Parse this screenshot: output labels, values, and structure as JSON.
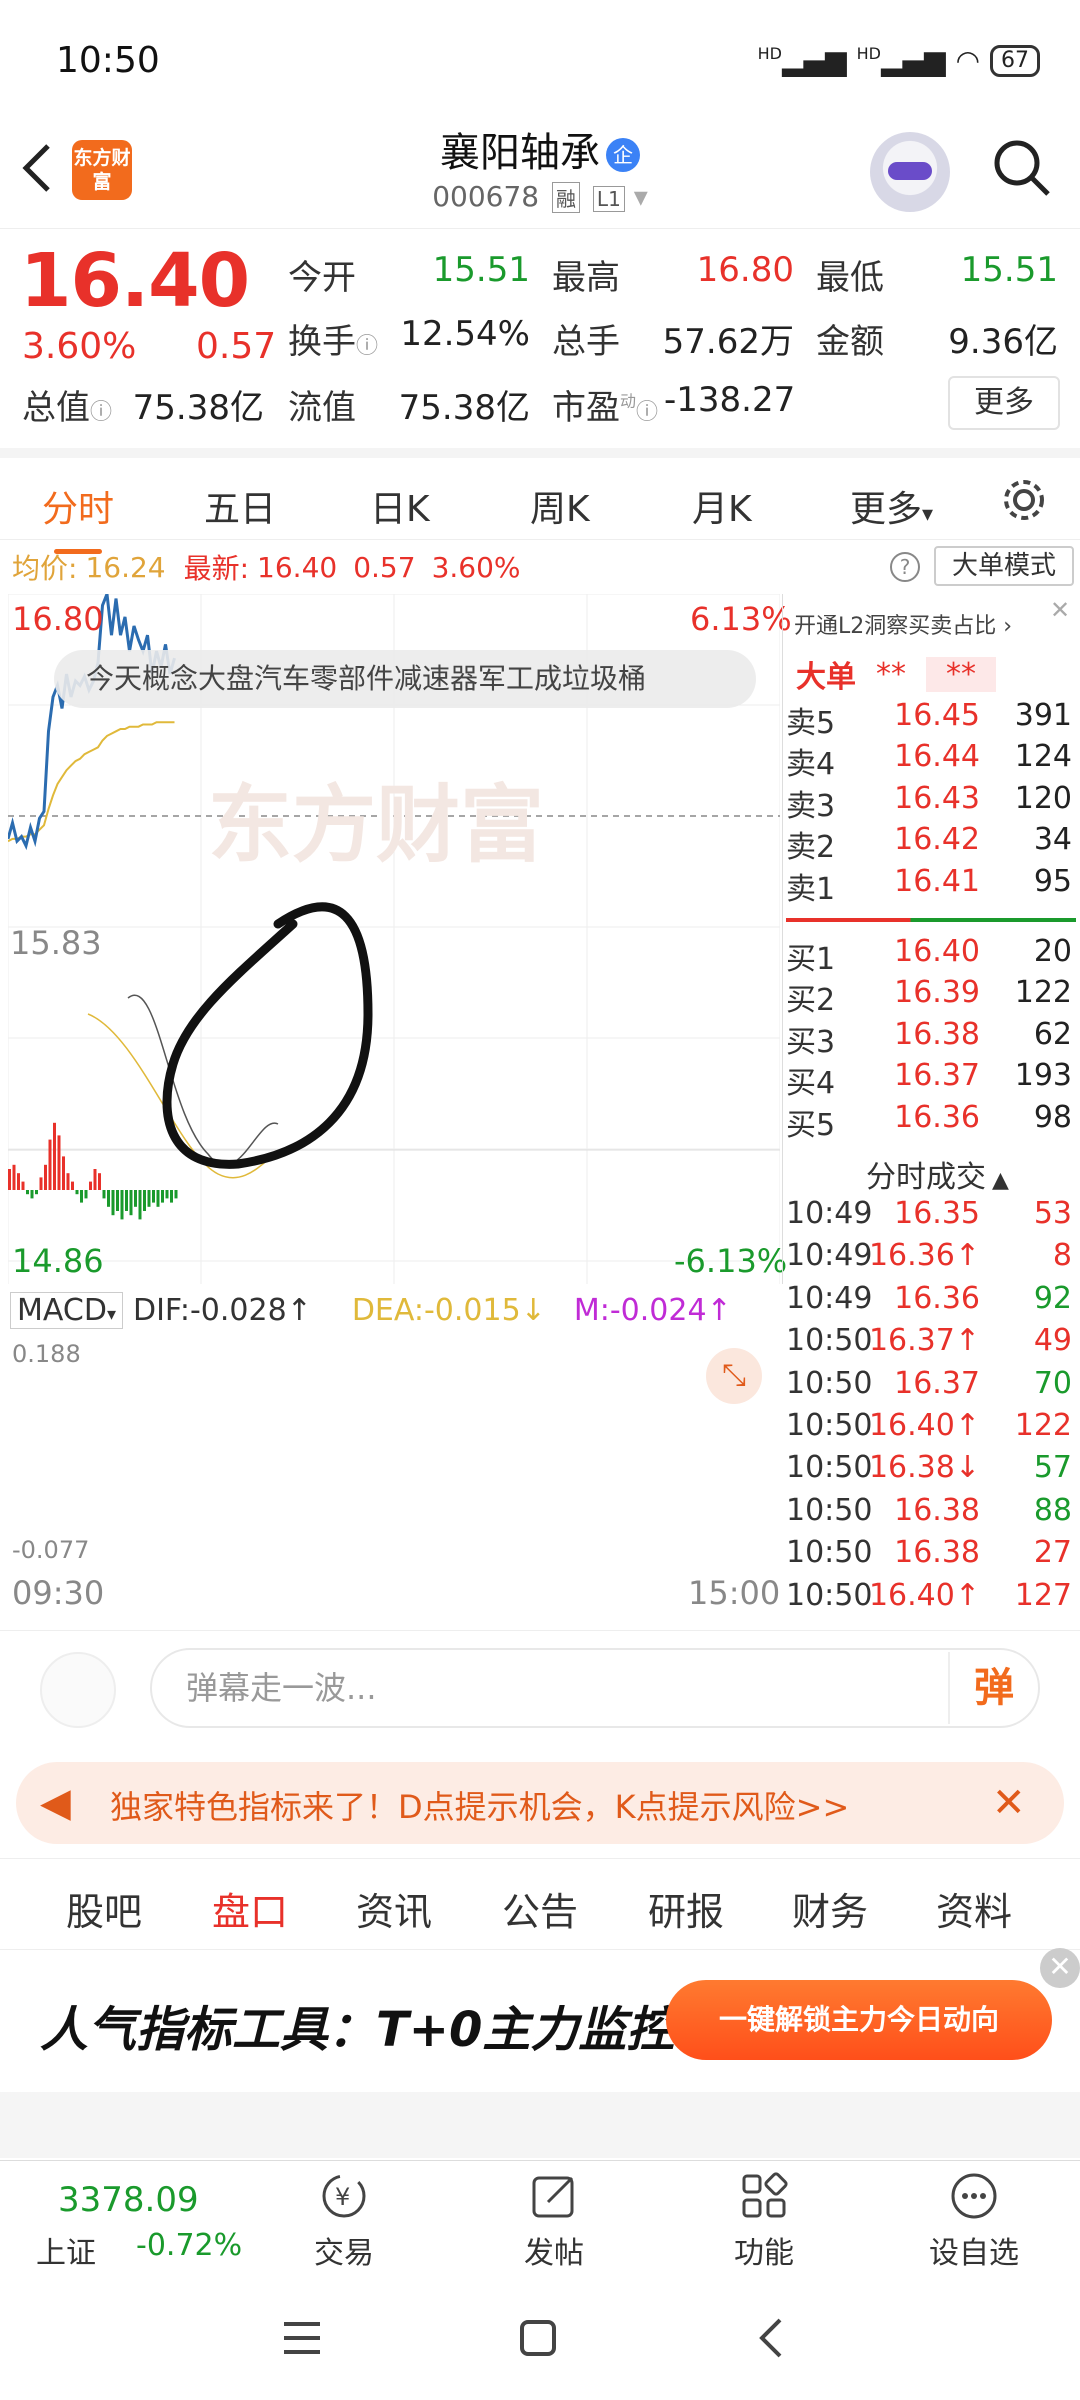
{
  "status": {
    "time": "10:50",
    "signal1": "HD",
    "signal2": "HD",
    "battery": "67"
  },
  "header": {
    "logo": "东方财富",
    "stock_name": "襄阳轴承",
    "badge": "企",
    "code": "000678",
    "tags": [
      "融",
      "L1"
    ]
  },
  "quote": {
    "price": "16.40",
    "pct": "3.60%",
    "change": "0.57",
    "fields": [
      {
        "label": "今开",
        "value": "15.51",
        "color": "green"
      },
      {
        "label": "最高",
        "value": "16.80",
        "color": "red"
      },
      {
        "label": "最低",
        "value": "15.51",
        "color": "green"
      },
      {
        "label": "换手",
        "value": "12.54%",
        "color": "black"
      },
      {
        "label": "总手",
        "value": "57.62万",
        "color": "black"
      },
      {
        "label": "金额",
        "value": "9.36亿",
        "color": "black"
      },
      {
        "label": "总值",
        "value": "75.38亿",
        "color": "black"
      },
      {
        "label": "流值",
        "value": "75.38亿",
        "color": "black"
      },
      {
        "label": "市盈",
        "value": "-138.27",
        "color": "black"
      }
    ],
    "more": "更多",
    "pe_sup": "动"
  },
  "chart_tabs": [
    "分时",
    "五日",
    "日K",
    "周K",
    "月K",
    "更多"
  ],
  "infoline": {
    "avg_label": "均价:",
    "avg_value": "16.24",
    "latest_label": "最新:",
    "latest_value": "16.40",
    "latest_change": "0.57",
    "latest_pct": "3.60%",
    "help": "?",
    "big_order_mode": "大单模式"
  },
  "chart": {
    "ticker": "今天概念大盘汽车零部件减速器军工成垃圾桶",
    "watermark": "东方财富",
    "y_top": "16.80",
    "y_mid": "15.83",
    "y_bottom": "14.86",
    "pct_top": "6.13%",
    "pct_bottom": "-6.13%",
    "macd_label": "MACD",
    "dif": "DIF:-0.028↑",
    "dea": "DEA:-0.015↓",
    "m": "M:-0.024↑",
    "macd_top": "0.188",
    "macd_bottom": "-0.077",
    "time_start": "09:30",
    "time_end": "15:00"
  },
  "chart_data": {
    "type": "line",
    "ylim": [
      14.86,
      16.8
    ],
    "series": [
      {
        "name": "",
        "values": [
          15.73,
          15.8,
          15.72,
          15.74,
          15.7,
          15.78,
          15.72,
          15.82,
          15.85,
          16.2,
          16.35,
          16.4,
          16.3,
          16.45,
          16.35,
          16.42,
          16.4,
          16.44,
          16.38,
          16.42,
          16.5,
          16.75,
          16.8,
          16.62,
          16.78,
          16.62,
          16.7,
          16.55,
          16.66,
          16.6,
          16.55,
          16.62,
          16.45,
          16.55,
          16.48,
          16.58,
          16.45,
          16.52
        ]
      },
      {
        "name": "",
        "values": [
          15.72,
          15.73,
          15.73,
          15.74,
          15.74,
          15.75,
          15.75,
          15.77,
          15.79,
          15.86,
          15.92,
          15.97,
          16.0,
          16.03,
          16.05,
          16.07,
          16.08,
          16.1,
          16.11,
          16.12,
          16.13,
          16.16,
          16.18,
          16.19,
          16.2,
          16.21,
          16.21,
          16.22,
          16.22,
          16.22,
          16.23,
          16.23,
          16.23,
          16.24,
          16.24,
          16.24,
          16.24,
          16.24
        ]
      }
    ],
    "macd_hist": [
      0.05,
      0.06,
      0.04,
      0.02,
      -0.01,
      -0.02,
      -0.01,
      0.03,
      0.06,
      0.12,
      0.16,
      0.13,
      0.08,
      0.04,
      0.02,
      -0.01,
      -0.03,
      -0.02,
      0.02,
      0.05,
      0.04,
      -0.02,
      -0.04,
      -0.06,
      -0.05,
      -0.07,
      -0.05,
      -0.06,
      -0.04,
      -0.07,
      -0.05,
      -0.04,
      -0.03,
      -0.04,
      -0.03,
      -0.02,
      -0.03,
      -0.02
    ]
  },
  "orderbook": {
    "header": "开通L2洞察买卖占比",
    "big_label": "大单",
    "big_mask1": "**",
    "big_mask2": "**",
    "asks": [
      {
        "label": "卖5",
        "price": "16.45",
        "vol": "391"
      },
      {
        "label": "卖4",
        "price": "16.44",
        "vol": "124"
      },
      {
        "label": "卖3",
        "price": "16.43",
        "vol": "120"
      },
      {
        "label": "卖2",
        "price": "16.42",
        "vol": "34"
      },
      {
        "label": "卖1",
        "price": "16.41",
        "vol": "95"
      }
    ],
    "bids": [
      {
        "label": "买1",
        "price": "16.40",
        "vol": "20"
      },
      {
        "label": "买2",
        "price": "16.39",
        "vol": "122"
      },
      {
        "label": "买3",
        "price": "16.38",
        "vol": "62"
      },
      {
        "label": "买4",
        "price": "16.37",
        "vol": "193"
      },
      {
        "label": "买5",
        "price": "16.36",
        "vol": "98"
      }
    ],
    "trades_title": "分时成交",
    "trades": [
      {
        "time": "10:49",
        "price": "16.35",
        "vol": "53",
        "price_color": "red",
        "vol_color": "red"
      },
      {
        "time": "10:49",
        "price": "16.36↑",
        "vol": "8",
        "price_color": "red",
        "vol_color": "red"
      },
      {
        "time": "10:49",
        "price": "16.36",
        "vol": "92",
        "price_color": "red",
        "vol_color": "green"
      },
      {
        "time": "10:50",
        "price": "16.37↑",
        "vol": "49",
        "price_color": "red",
        "vol_color": "red"
      },
      {
        "time": "10:50",
        "price": "16.37",
        "vol": "70",
        "price_color": "red",
        "vol_color": "green"
      },
      {
        "time": "10:50",
        "price": "16.40↑",
        "vol": "122",
        "price_color": "red",
        "vol_color": "red"
      },
      {
        "time": "10:50",
        "price": "16.38↓",
        "vol": "57",
        "price_color": "red",
        "vol_color": "green"
      },
      {
        "time": "10:50",
        "price": "16.38",
        "vol": "88",
        "price_color": "red",
        "vol_color": "green"
      },
      {
        "time": "10:50",
        "price": "16.38",
        "vol": "27",
        "price_color": "red",
        "vol_color": "red"
      },
      {
        "time": "10:50",
        "price": "16.40↑",
        "vol": "127",
        "price_color": "red",
        "vol_color": "red"
      }
    ]
  },
  "danmu": {
    "placeholder": "弹幕走一波...",
    "button": "弹"
  },
  "notice": {
    "text": "独家特色指标来了！D点提示机会，K点提示风险>>",
    "close": "✕"
  },
  "info_tabs": [
    "股吧",
    "盘口",
    "资讯",
    "公告",
    "研报",
    "财务",
    "资料"
  ],
  "ad": {
    "title": "人气指标工具：T+0主力监控",
    "button": "一键解锁主力今日动向",
    "close": "✕"
  },
  "bottom_nav": {
    "index_value": "3378.09",
    "index_name": "上证",
    "index_pct": "-0.72%",
    "items": [
      "交易",
      "发帖",
      "功能",
      "设自选"
    ]
  },
  "colors": {
    "accent": "#f26b1d",
    "up": "#e8312a",
    "down": "#1a9a2c",
    "price_line": "#2b6cb0",
    "avg_line": "#e0b93a"
  }
}
